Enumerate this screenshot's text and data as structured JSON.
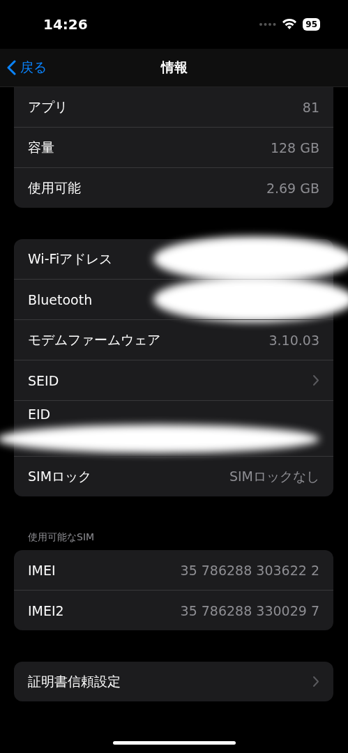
{
  "status_bar": {
    "time": "14:26",
    "battery": "95"
  },
  "nav": {
    "back": "戻る",
    "title": "情報"
  },
  "groups": [
    {
      "rows": [
        {
          "label": "アプリ",
          "kind": "value",
          "value": "81"
        },
        {
          "label": "容量",
          "kind": "value",
          "value": "128 GB"
        },
        {
          "label": "使用可能",
          "kind": "value",
          "value": "2.69 GB"
        }
      ]
    },
    {
      "rows": [
        {
          "label": "Wi-Fiアドレス",
          "kind": "redacted"
        },
        {
          "label": "Bluetooth",
          "kind": "redacted"
        },
        {
          "label": "モデムファームウェア",
          "kind": "value",
          "value": "3.10.03"
        },
        {
          "label": "SEID",
          "kind": "chevron"
        },
        {
          "label": "EID",
          "kind": "redacted-full"
        },
        {
          "label": "SIMロック",
          "kind": "value",
          "value": "SIMロックなし"
        }
      ]
    },
    {
      "header": "使用可能なSIM",
      "rows": [
        {
          "label": "IMEI",
          "kind": "value",
          "value": "35 786288 303622 2"
        },
        {
          "label": "IMEI2",
          "kind": "value",
          "value": "35 786288 330029 7"
        }
      ]
    },
    {
      "rows": [
        {
          "label": "証明書信頼設定",
          "kind": "chevron"
        }
      ]
    }
  ]
}
